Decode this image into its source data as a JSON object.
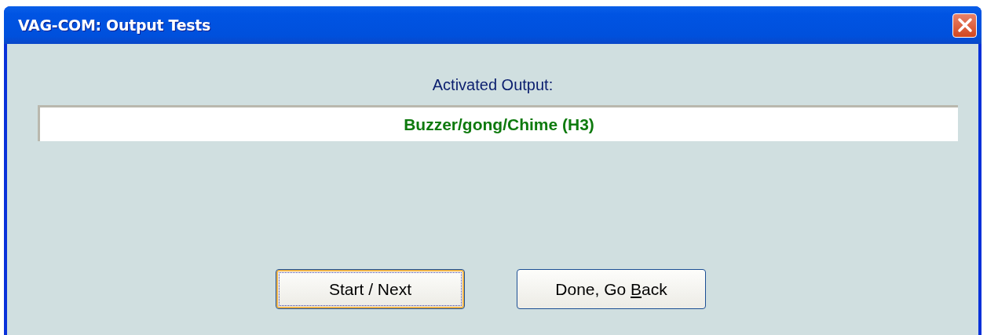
{
  "window": {
    "title": "VAG-COM: Output Tests"
  },
  "output_label": "Activated Output:",
  "output_value": "Buzzer/gong/Chime (H3)",
  "buttons": [
    {
      "label": "Start / Next",
      "focused": true
    },
    {
      "label": "Done, Go ",
      "mnemonic": "B",
      "label_rest": "ack",
      "focused": false
    }
  ]
}
